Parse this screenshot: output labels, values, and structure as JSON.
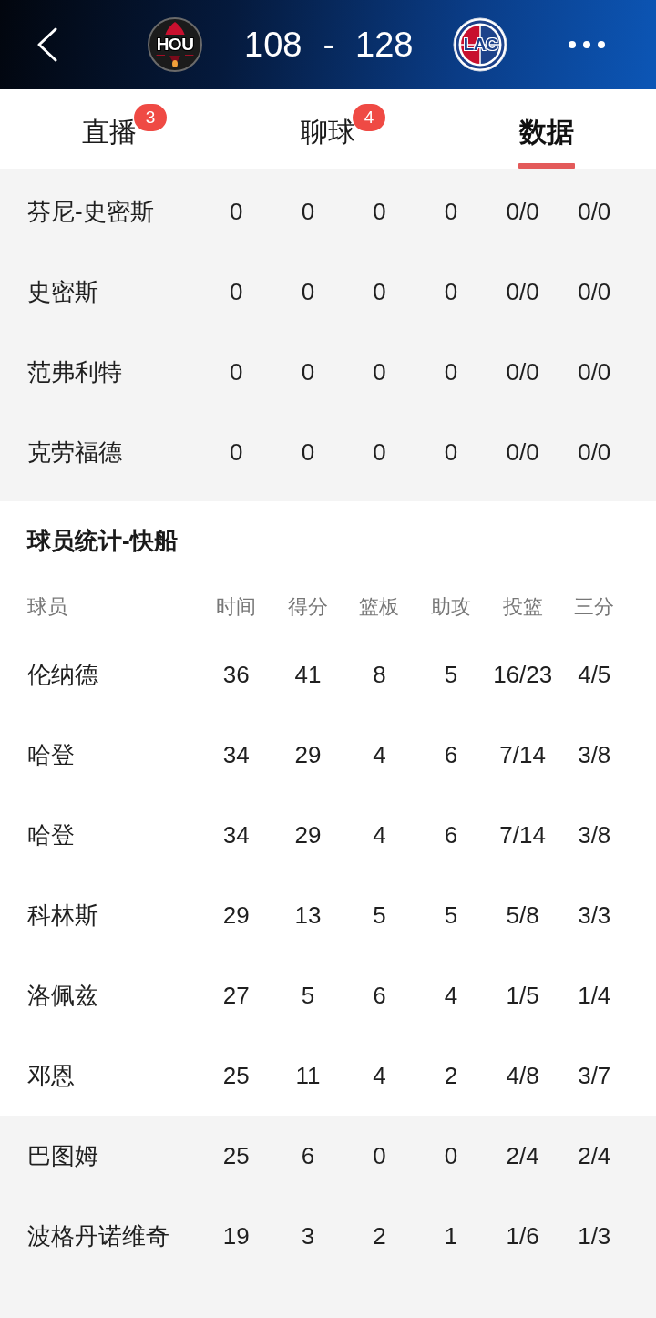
{
  "header": {
    "home": {
      "abbr": "HOU"
    },
    "score_home": "108",
    "score_separator": "-",
    "score_away": "128",
    "away": {
      "abbr": "LAC"
    }
  },
  "tabs": [
    {
      "label": "直播",
      "badge": "3",
      "selected": false
    },
    {
      "label": "聊球",
      "badge": "4",
      "selected": false
    },
    {
      "label": "数据",
      "selected": true
    }
  ],
  "upper_table": {
    "rows": [
      [
        "芬尼-史密斯",
        "0",
        "0",
        "0",
        "0",
        "0/0",
        "0/0"
      ],
      [
        "史密斯",
        "0",
        "0",
        "0",
        "0",
        "0/0",
        "0/0"
      ],
      [
        "范弗利特",
        "0",
        "0",
        "0",
        "0",
        "0/0",
        "0/0"
      ],
      [
        "克劳福德",
        "0",
        "0",
        "0",
        "0",
        "0/0",
        "0/0"
      ]
    ]
  },
  "clippers_stats": {
    "title": "球员统计-快船",
    "columns": [
      "球员",
      "时间",
      "得分",
      "篮板",
      "助攻",
      "投篮",
      "三分"
    ],
    "row_groups": [
      {
        "rows": [
          [
            "伦纳德",
            "36",
            "41",
            "8",
            "5",
            "16/23",
            "4/5"
          ],
          [
            "哈登",
            "34",
            "29",
            "4",
            "6",
            "7/14",
            "3/8"
          ],
          [
            "哈登",
            "34",
            "29",
            "4",
            "6",
            "7/14",
            "3/8"
          ],
          [
            "科林斯",
            "29",
            "13",
            "5",
            "5",
            "5/8",
            "3/3"
          ],
          [
            "洛佩兹",
            "27",
            "5",
            "6",
            "4",
            "1/5",
            "1/4"
          ],
          [
            "邓恩",
            "25",
            "11",
            "4",
            "2",
            "4/8",
            "3/7"
          ]
        ]
      },
      {
        "rows": [
          [
            "巴图姆",
            "25",
            "6",
            "0",
            "0",
            "2/4",
            "2/4"
          ],
          [
            "波格丹诺维奇",
            "19",
            "3",
            "2",
            "1",
            "1/6",
            "1/3"
          ]
        ]
      }
    ]
  }
}
